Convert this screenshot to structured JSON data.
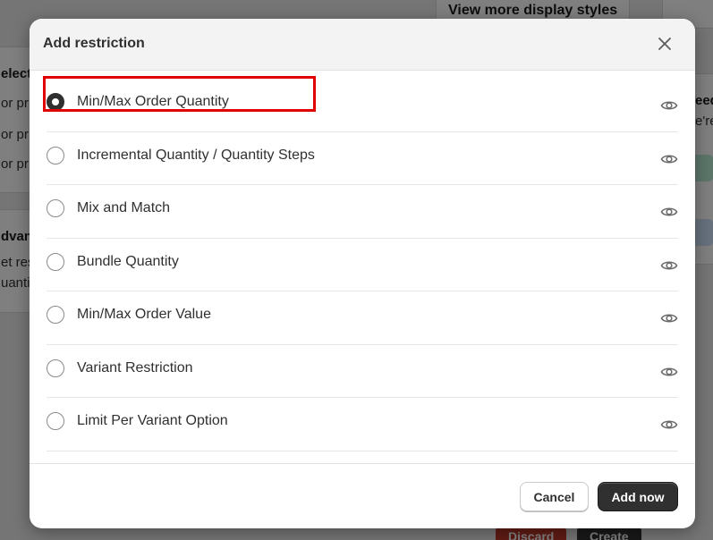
{
  "background": {
    "top_button": "View more display styles",
    "left_card1": {
      "title": "elect",
      "lines": [
        "or pr",
        "or pr",
        "or pr"
      ]
    },
    "left_card2": {
      "title": "dvan",
      "lines": [
        "et res",
        "uanti"
      ]
    },
    "right_card": {
      "title": "eed",
      "line": "e're"
    },
    "footer_buttons": {
      "discard": "Discard",
      "create": "Create"
    }
  },
  "modal": {
    "title": "Add restriction",
    "options": [
      {
        "label": "Min/Max Order Quantity",
        "selected": true
      },
      {
        "label": "Incremental Quantity / Quantity Steps",
        "selected": false
      },
      {
        "label": "Mix and Match",
        "selected": false
      },
      {
        "label": "Bundle Quantity",
        "selected": false
      },
      {
        "label": "Min/Max Order Value",
        "selected": false
      },
      {
        "label": "Variant Restriction",
        "selected": false
      },
      {
        "label": "Limit Per Variant Option",
        "selected": false
      }
    ],
    "cancel_label": "Cancel",
    "add_label": "Add now"
  },
  "colors": {
    "highlight": "#e00000",
    "primary_button": "#303030",
    "discard_button": "#c0392b"
  }
}
